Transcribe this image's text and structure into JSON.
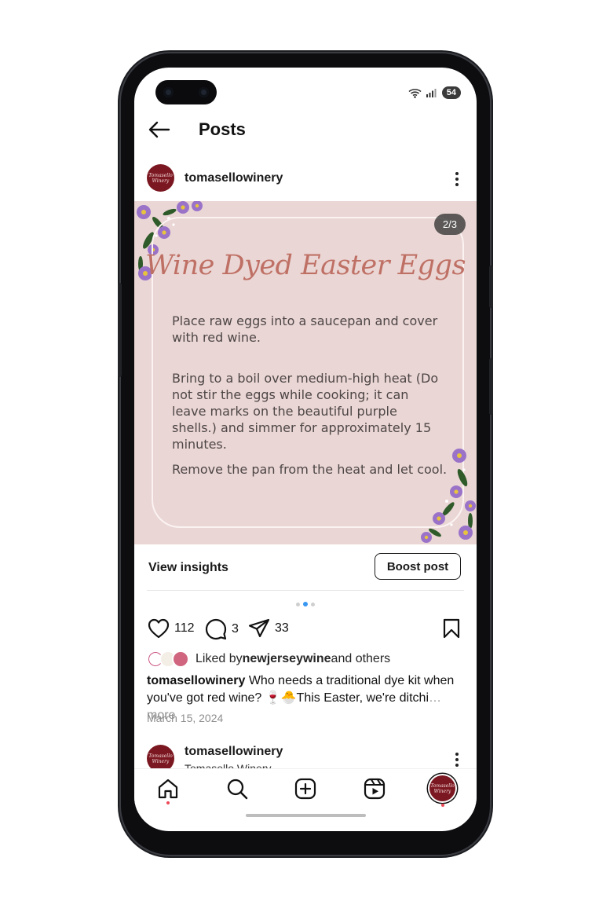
{
  "status_bar": {
    "battery": "54"
  },
  "header": {
    "title": "Posts"
  },
  "post": {
    "username": "tomasellowinery",
    "avatar_text": "Tomasello Winery",
    "slide_counter": "2/3",
    "image": {
      "title": "Wine Dyed Easter Eggs",
      "paragraphs": [
        "Place raw eggs into a saucepan and cover with red wine.",
        "Bring to a boil over medium-high heat (Do not stir the eggs while cooking; it can leave marks on the beautiful purple shells.) and simmer for approximately 15 minutes.",
        "Remove the pan from the heat and let cool."
      ]
    },
    "view_insights": "View insights",
    "boost_post": "Boost post",
    "likes": "112",
    "comments": "3",
    "shares": "33",
    "liked_by_prefix": "Liked by ",
    "liked_by_user": "newjerseywine",
    "liked_by_suffix": " and others",
    "caption_user": "tomasellowinery",
    "caption_text": " Who needs a traditional dye kit when you've got red wine? 🍷🐣This Easter, we're ditchi",
    "caption_more": "… more",
    "date": "March 15, 2024"
  },
  "next_post": {
    "username": "tomasellowinery",
    "subtitle": "Tomasello Winery"
  },
  "colors": {
    "image_bg": "#ead6d4",
    "title_rose": "#bf7065",
    "brand_maroon": "#7b1720",
    "active_dot": "#3897f0",
    "notification_dot": "#ed4956"
  },
  "icons": [
    "back-arrow-icon",
    "wifi-icon",
    "signal-icon",
    "more-icon",
    "heart-icon",
    "comment-icon",
    "share-icon",
    "bookmark-icon",
    "home-icon",
    "search-icon",
    "create-icon",
    "reels-icon",
    "profile-icon"
  ]
}
